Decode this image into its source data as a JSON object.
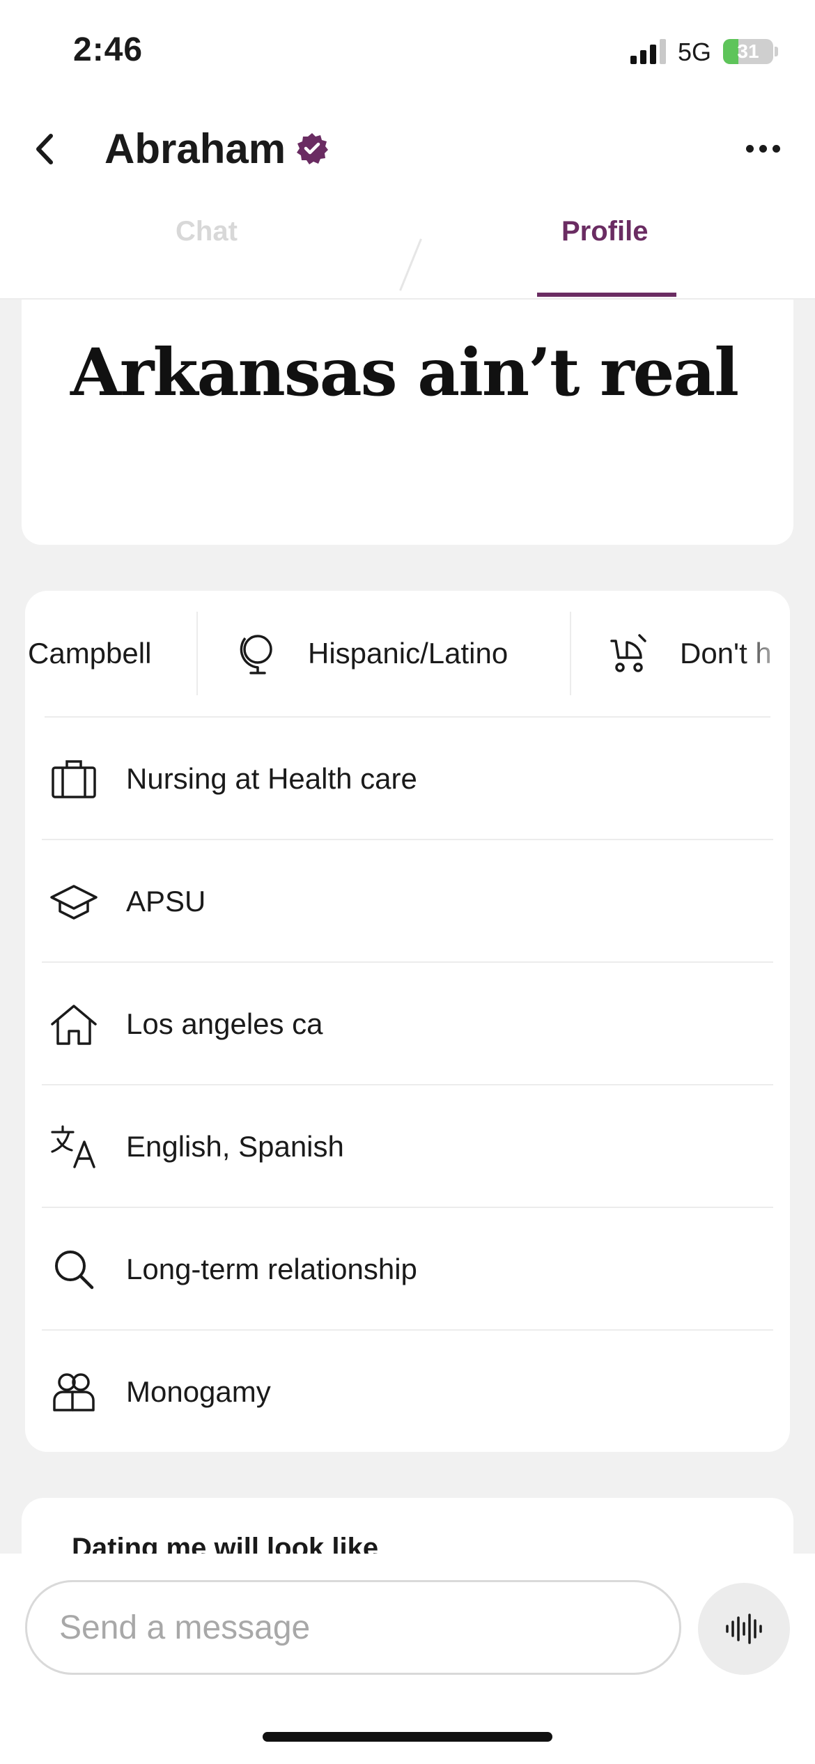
{
  "status_bar": {
    "time": "2:46",
    "network": "5G",
    "battery_percent": "31",
    "battery_level": 0.31,
    "signal_bars_active": 3
  },
  "header": {
    "title": "Abraham",
    "verified_icon": "verified-badge-icon",
    "back_icon": "chevron-left-icon",
    "more_icon": "more-dots-icon"
  },
  "tabs": [
    {
      "label": "Chat",
      "active": false
    },
    {
      "label": "Profile",
      "active": true
    }
  ],
  "prompt": {
    "answer": "Arkansas ain’t real"
  },
  "chips": [
    {
      "label": "Campbell",
      "icon": "none"
    },
    {
      "label": "Hispanic/Latino",
      "icon": "globe-icon"
    },
    {
      "label": "Don't h",
      "icon": "stroller-icon"
    }
  ],
  "details": [
    {
      "icon": "briefcase-icon",
      "label": "Nursing at Health care"
    },
    {
      "icon": "graduation-cap-icon",
      "label": "APSU"
    },
    {
      "icon": "home-icon",
      "label": "Los angeles ca"
    },
    {
      "icon": "translate-icon",
      "label": "English, Spanish"
    },
    {
      "icon": "search-icon",
      "label": "Long-term relationship"
    },
    {
      "icon": "people-icon",
      "label": "Monogamy"
    }
  ],
  "next_section": {
    "title": "Dating me will look like"
  },
  "composer": {
    "placeholder": "Send a message",
    "voice_icon": "voice-waveform-icon"
  },
  "colors": {
    "accent": "#6a2c62",
    "background": "#f1f1f1",
    "card": "#ffffff",
    "battery_fill": "#5ec45a"
  }
}
